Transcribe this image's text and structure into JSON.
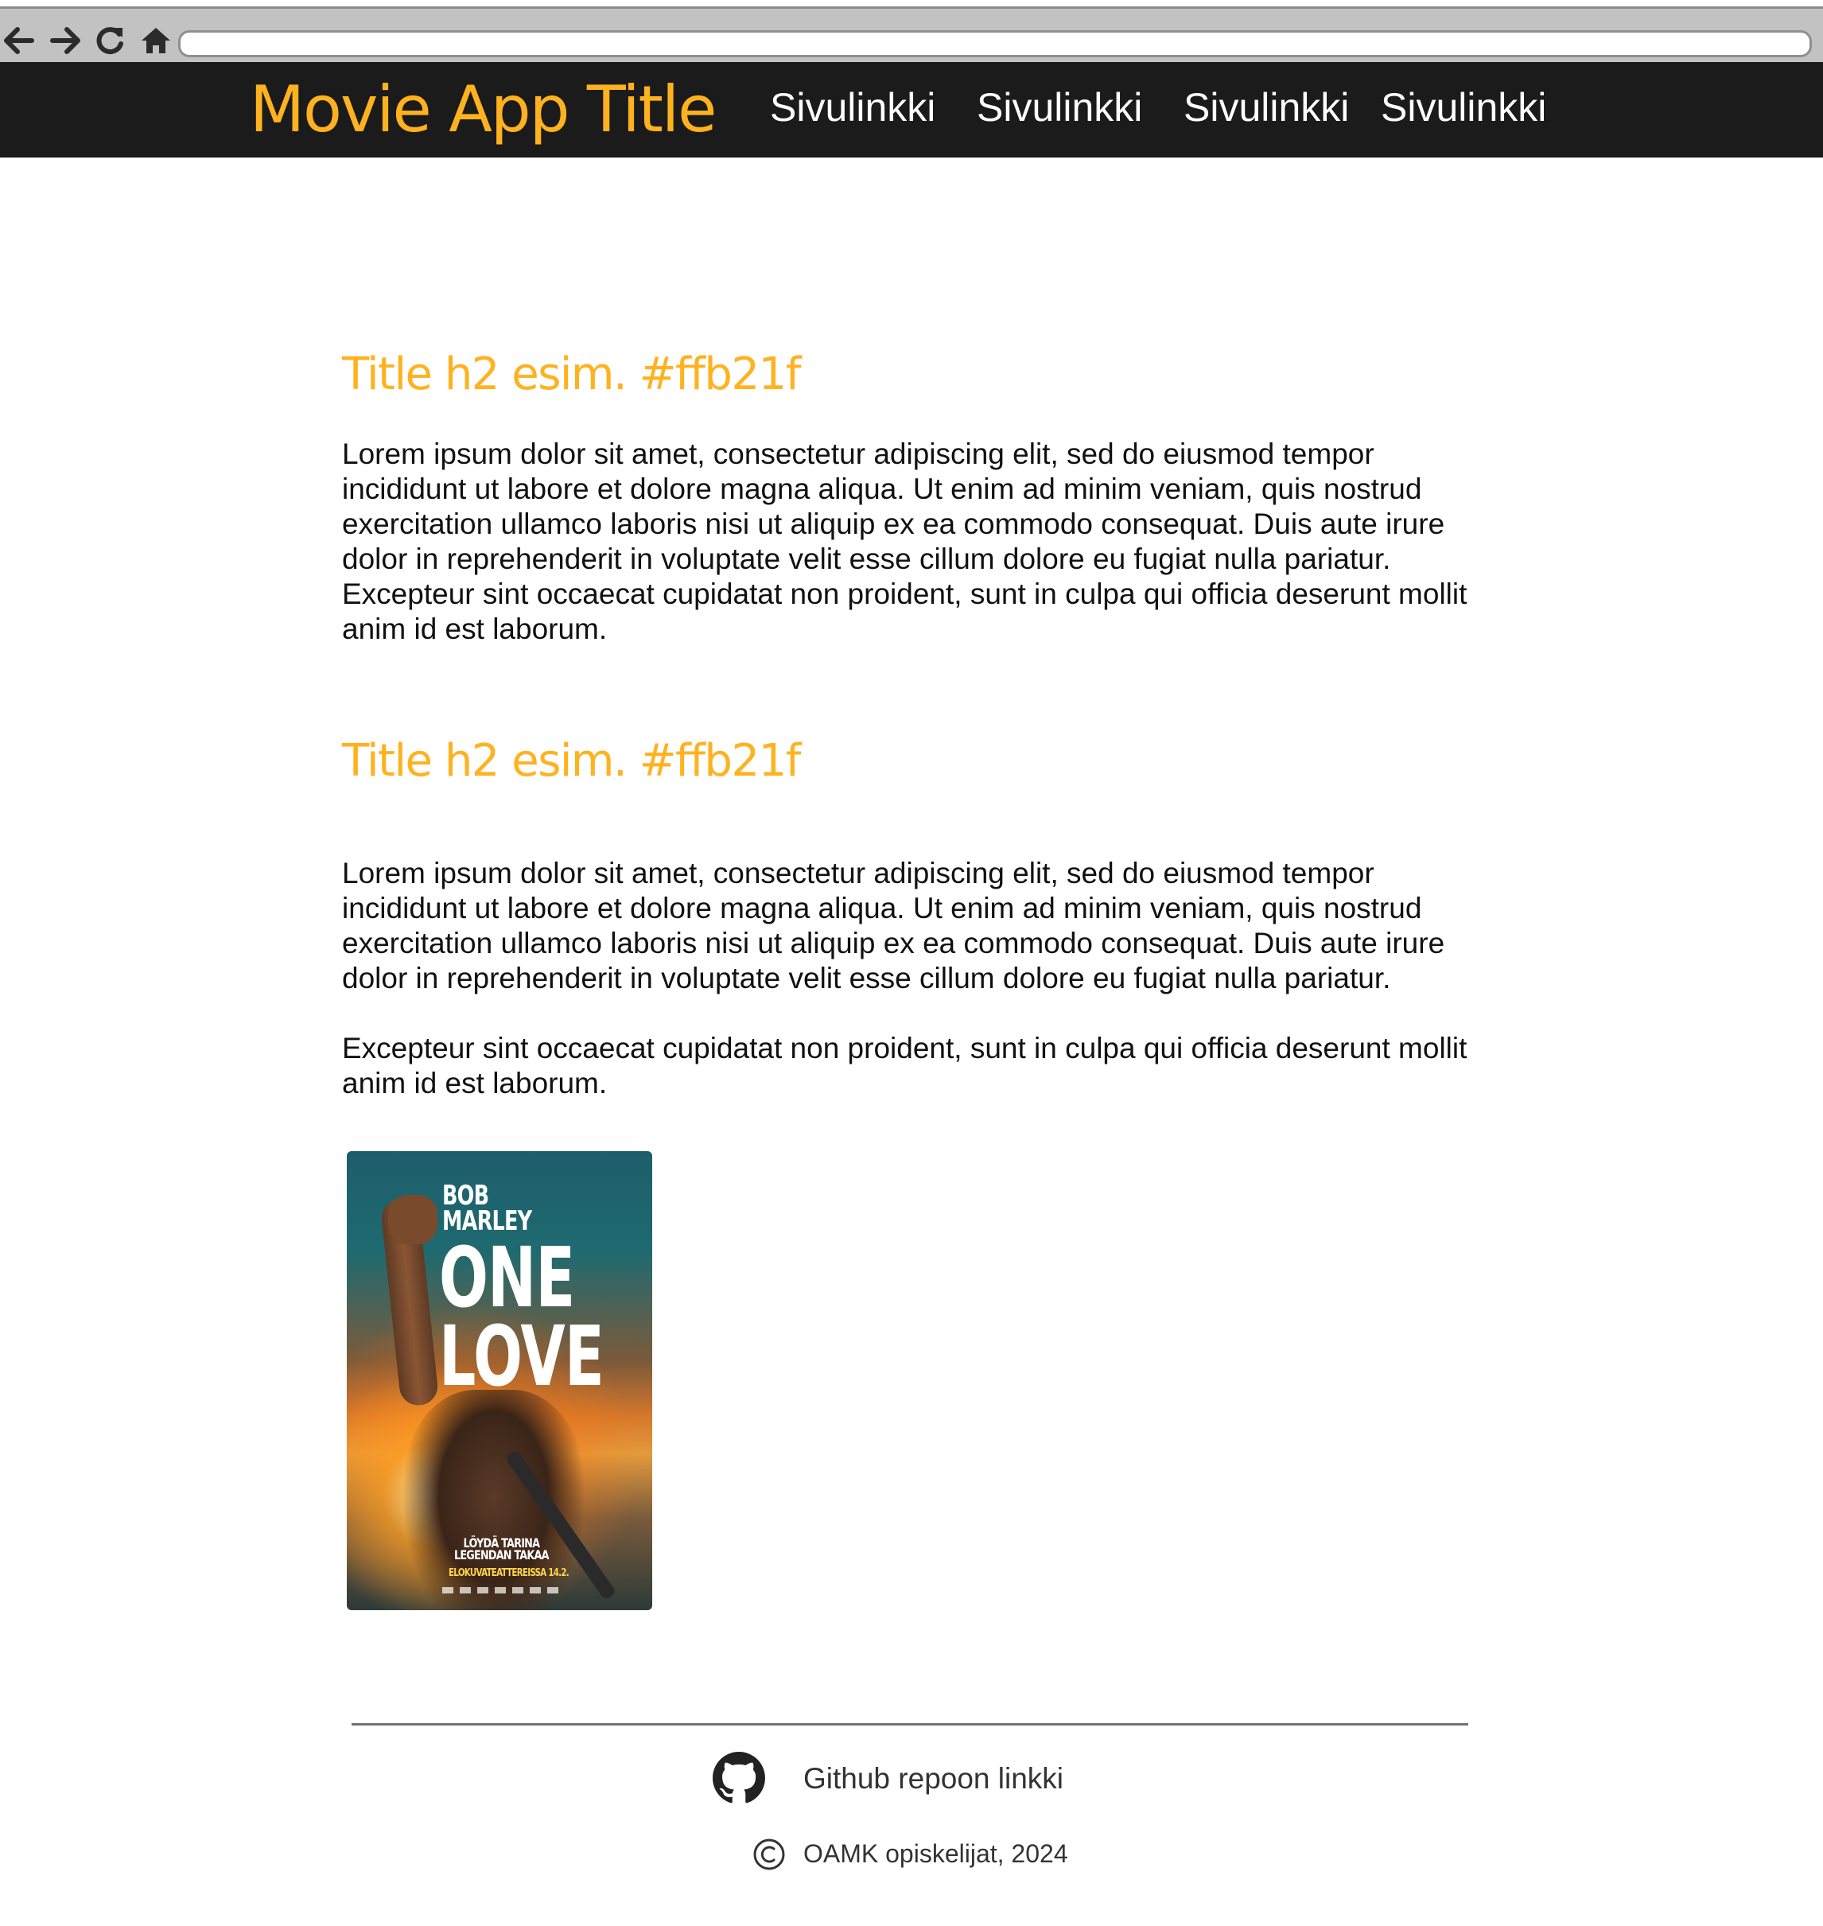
{
  "browser": {
    "back_icon": "arrow-left-icon",
    "forward_icon": "arrow-right-icon",
    "reload_icon": "reload-icon",
    "home_icon": "home-icon",
    "address_value": ""
  },
  "header": {
    "title": "Movie App Title",
    "title_color": "#ffb21f",
    "background": "#1b1b1b",
    "nav_links": [
      "Sivulinkki",
      "Sivulinkki",
      "Sivulinkki",
      "Sivulinkki"
    ]
  },
  "main": {
    "sections": [
      {
        "heading": "Title h2 esim. #ffb21f",
        "paragraphs": [
          "Lorem ipsum dolor sit amet, consectetur adipiscing elit, sed do eiusmod tempor incididunt ut labore et dolore magna aliqua. Ut enim ad minim veniam, quis nostrud exercitation ullamco laboris nisi ut aliquip ex ea commodo consequat. Duis aute irure dolor in reprehenderit in voluptate velit esse cillum dolore eu fugiat nulla pariatur. Excepteur sint occaecat cupidatat non proident, sunt in culpa qui officia deserunt mollit anim id est laborum."
        ]
      },
      {
        "heading": "Title h2 esim. #ffb21f",
        "paragraphs": [
          "Lorem ipsum dolor sit amet, consectetur adipiscing elit, sed do eiusmod tempor incididunt ut labore et dolore magna aliqua. Ut enim ad minim veniam, quis nostrud exercitation ullamco laboris nisi ut aliquip ex ea commodo consequat. Duis aute irure dolor in reprehenderit in voluptate velit esse cillum dolore eu fugiat nulla pariatur.",
          "Excepteur sint occaecat cupidatat non proident, sunt in culpa qui officia deserunt mollit anim id est laborum."
        ]
      }
    ],
    "poster": {
      "name_line1": "BOB",
      "name_line2": "MARLEY",
      "title_line1": "ONE",
      "title_line2": "LOVE",
      "tagline_line1": "LÖYDÄ TARINA",
      "tagline_line2": "LEGENDAN TAKAA",
      "release": "ELOKUVATEATTEREISSA 14.2."
    }
  },
  "footer": {
    "github_icon": "github-icon",
    "github_label": "Github repoon linkki",
    "copyright_icon": "copyright-icon",
    "copyright_text": "OAMK opiskelijat, 2024",
    "text_color": "#333333"
  }
}
